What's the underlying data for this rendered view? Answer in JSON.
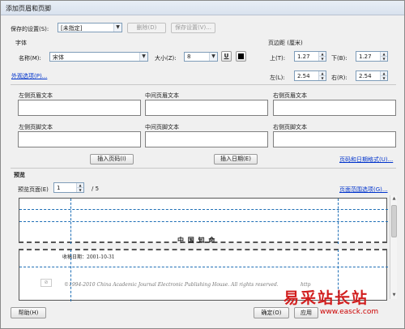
{
  "window": {
    "title": "添加页眉和页脚"
  },
  "settings": {
    "saved_label": "保存的设置(S):",
    "saved_value": "[未指定]",
    "delete_label": "删除(D)",
    "save_label": "保存设置(V)..."
  },
  "font": {
    "group_label": "字体",
    "name_label": "名称(M):",
    "name_value": "宋体",
    "size_label": "大小(Z):",
    "size_value": "8",
    "underline_label": "U"
  },
  "margins": {
    "group_label": "页边距 (厘米)",
    "top_label": "上(T):",
    "top_value": "1.27",
    "bottom_label": "下(B):",
    "bottom_value": "1.27",
    "left_label": "左(L):",
    "left_value": "2.54",
    "right_label": "右(R):",
    "right_value": "2.54"
  },
  "appearance_link": "外观选项(P)...",
  "header_footer": {
    "left_header": "左侧页眉文本",
    "center_header": "中间页眉文本",
    "right_header": "右侧页眉文本",
    "left_footer": "左侧页脚文本",
    "center_footer": "中间页脚文本",
    "right_footer": "右侧页脚文本"
  },
  "insert": {
    "page_number": "插入页码(I)",
    "date": "插入日期(E)",
    "format_link": "页码和日期格式(U)..."
  },
  "preview": {
    "group_label": "预览",
    "page_label": "预览页面(E)",
    "page_value": "1",
    "page_total": "/ 5",
    "range_link": "页面范围选项(G)...",
    "page_header_text": "中 国 知 命",
    "received_text": "收稿日期：2001-10-31",
    "copyright_text": "©1994-2010 China Academic Journal Electronic Publishing House. All rights reserved.",
    "copyright_tail": "http"
  },
  "buttons": {
    "help": "帮助(H)",
    "ok": "确定(O)",
    "apply": "应用"
  },
  "watermark": {
    "text": "易采站长站",
    "url": "www.easck.com",
    "color": "#d11e1e"
  }
}
